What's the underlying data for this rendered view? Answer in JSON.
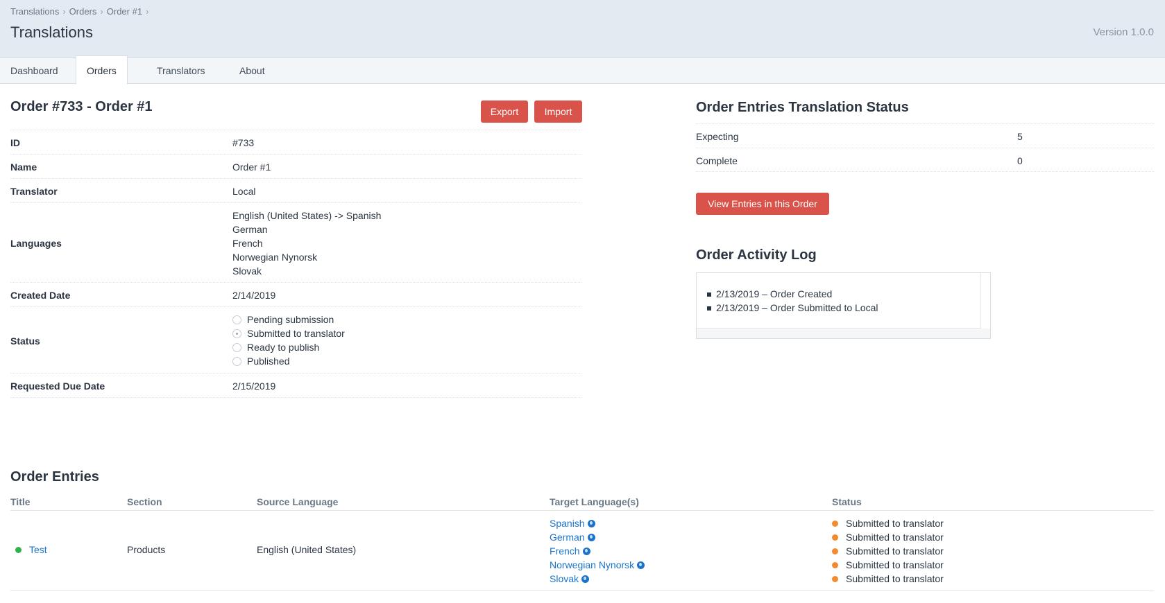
{
  "breadcrumbs": [
    "Translations",
    "Orders",
    "Order #1"
  ],
  "page_title": "Translations",
  "version": "Version 1.0.0",
  "tabs": [
    {
      "label": "Dashboard",
      "active": false
    },
    {
      "label": "Orders",
      "active": true
    },
    {
      "label": "Translators",
      "active": false
    },
    {
      "label": "About",
      "active": false
    }
  ],
  "order": {
    "heading": "Order #733 - Order #1",
    "export_label": "Export",
    "import_label": "Import",
    "fields": {
      "id": {
        "label": "ID",
        "value": "#733"
      },
      "name": {
        "label": "Name",
        "value": "Order #1"
      },
      "translator": {
        "label": "Translator",
        "value": "Local"
      },
      "languages": {
        "label": "Languages",
        "values": [
          "English (United States) -> Spanish",
          "German",
          "French",
          "Norwegian Nynorsk",
          "Slovak"
        ]
      },
      "created": {
        "label": "Created Date",
        "value": "2/14/2019"
      },
      "status": {
        "label": "Status",
        "options": [
          "Pending submission",
          "Submitted to translator",
          "Ready to publish",
          "Published"
        ],
        "selected": "Submitted to translator"
      },
      "due": {
        "label": "Requested Due Date",
        "value": "2/15/2019"
      }
    }
  },
  "translation_status": {
    "heading": "Order Entries Translation Status",
    "rows": [
      {
        "label": "Expecting",
        "value": "5"
      },
      {
        "label": "Complete",
        "value": "0"
      }
    ],
    "view_button": "View Entries in this Order"
  },
  "activity_log": {
    "heading": "Order Activity Log",
    "items": [
      "2/13/2019 – Order Created",
      "2/13/2019 – Order Submitted to Local"
    ]
  },
  "entries": {
    "heading": "Order Entries",
    "columns": [
      "Title",
      "Section",
      "Source Language",
      "Target Language(s)",
      "Status"
    ],
    "rows": [
      {
        "title": "Test",
        "section": "Products",
        "source": "English (United States)",
        "targets": [
          "Spanish",
          "German",
          "French",
          "Norwegian Nynorsk",
          "Slovak"
        ],
        "statuses": [
          "Submitted to translator",
          "Submitted to translator",
          "Submitted to translator",
          "Submitted to translator",
          "Submitted to translator"
        ]
      }
    ]
  },
  "colors": {
    "accent_button": "#d9534a",
    "link": "#1a73c9",
    "status_enabled": "#2fb44b",
    "status_submitted": "#f28a2e",
    "header_bg": "#e4eaf1"
  },
  "icons": {
    "target_language_icon": "globe-icon",
    "entry_status_icon": "status-dot-icon"
  }
}
